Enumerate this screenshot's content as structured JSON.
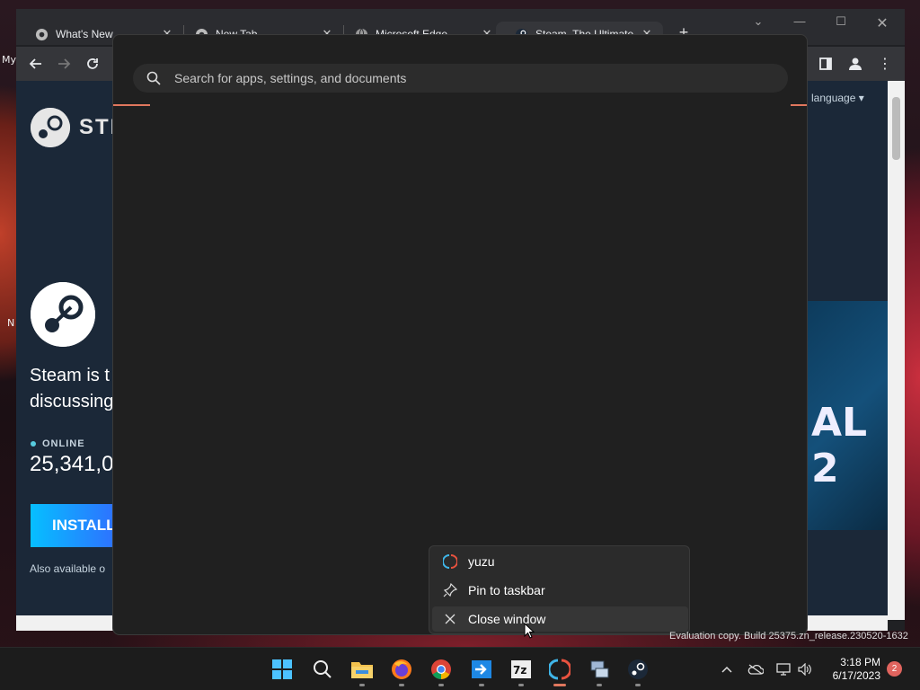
{
  "desktop": {
    "icon_labels": [
      "My",
      "N"
    ]
  },
  "browser": {
    "tabs": [
      {
        "title": "What's New",
        "icon": "chrome-icon"
      },
      {
        "title": "New Tab",
        "icon": "chrome-icon"
      },
      {
        "title": "Microsoft Edge",
        "icon": "globe-icon"
      },
      {
        "title": "Steam, The Ultimate",
        "icon": "steam-icon",
        "active": true
      }
    ],
    "new_tab_label": "+",
    "page": {
      "logo_text": "STI",
      "language_label": "language",
      "headline_line1": "Steam is t",
      "headline_line2": "discussing",
      "online_label": "ONLINE",
      "online_count": "25,341,0",
      "install_label": "INSTALL",
      "also_available": "Also available o",
      "hero_text": "AL 2"
    }
  },
  "search": {
    "placeholder": "Search for apps, settings, and documents"
  },
  "jumplist": {
    "items": [
      {
        "label": "yuzu",
        "icon": "yuzu-icon"
      },
      {
        "label": "Pin to taskbar",
        "icon": "pin-icon"
      },
      {
        "label": "Close window",
        "icon": "close-icon"
      }
    ]
  },
  "watermark": "Evaluation copy. Build 25375.zn_release.230520-1632",
  "taskbar": {
    "apps": [
      "start-icon",
      "search-icon",
      "file-explorer-icon",
      "firefox-icon",
      "chrome-icon",
      "remote-app-icon",
      "7zip-icon",
      "yuzu-icon",
      "network-app-icon",
      "steam-icon"
    ],
    "clock_time": "3:18 PM",
    "clock_date": "6/17/2023",
    "notification_count": "2"
  },
  "colors": {
    "accent": "#e0775e",
    "panel_bg": "#202020",
    "steam_bg": "#1b2838",
    "install_gradient_start": "#06bfff",
    "install_gradient_end": "#2d73ff"
  }
}
